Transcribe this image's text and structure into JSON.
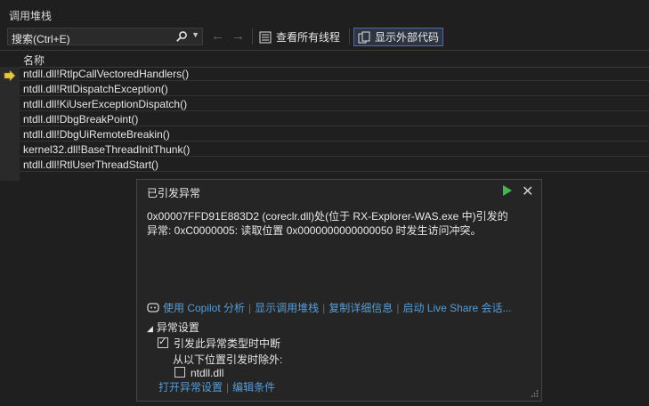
{
  "panel": {
    "title": "调用堆栈"
  },
  "toolbar": {
    "search_value": "搜索(Ctrl+E)",
    "view_all_threads": "查看所有线程",
    "show_external_code": "显示外部代码"
  },
  "grid": {
    "column_name": "名称",
    "rows": [
      "ntdll.dll!RtlpCallVectoredHandlers()",
      "ntdll.dll!RtlDispatchException()",
      "ntdll.dll!KiUserExceptionDispatch()",
      "ntdll.dll!DbgBreakPoint()",
      "ntdll.dll!DbgUiRemoteBreakin()",
      "kernel32.dll!BaseThreadInitThunk()",
      "ntdll.dll!RtlUserThreadStart()"
    ]
  },
  "popup": {
    "title": "已引发异常",
    "message_line1": "0x00007FFD91E883D2 (coreclr.dll)处(位于 RX-Explorer-WAS.exe 中)引发的",
    "message_line2": "异常: 0xC0000005: 读取位置 0x0000000000000050 时发生访问冲突。",
    "links": [
      "使用 Copilot 分析",
      "显示调用堆栈",
      "复制详细信息",
      "启动 Live Share 会话..."
    ],
    "settings_header": "异常设置",
    "break_when_thrown": "引发此异常类型时中断",
    "except_when_from": "从以下位置引发时除外:",
    "module": "ntdll.dll",
    "open_settings": "打开异常设置",
    "edit_conditions": "编辑条件"
  },
  "colors": {
    "accent_link": "#569cd6",
    "play_green": "#3fb950",
    "arrow_yellow": "#e8c840"
  }
}
